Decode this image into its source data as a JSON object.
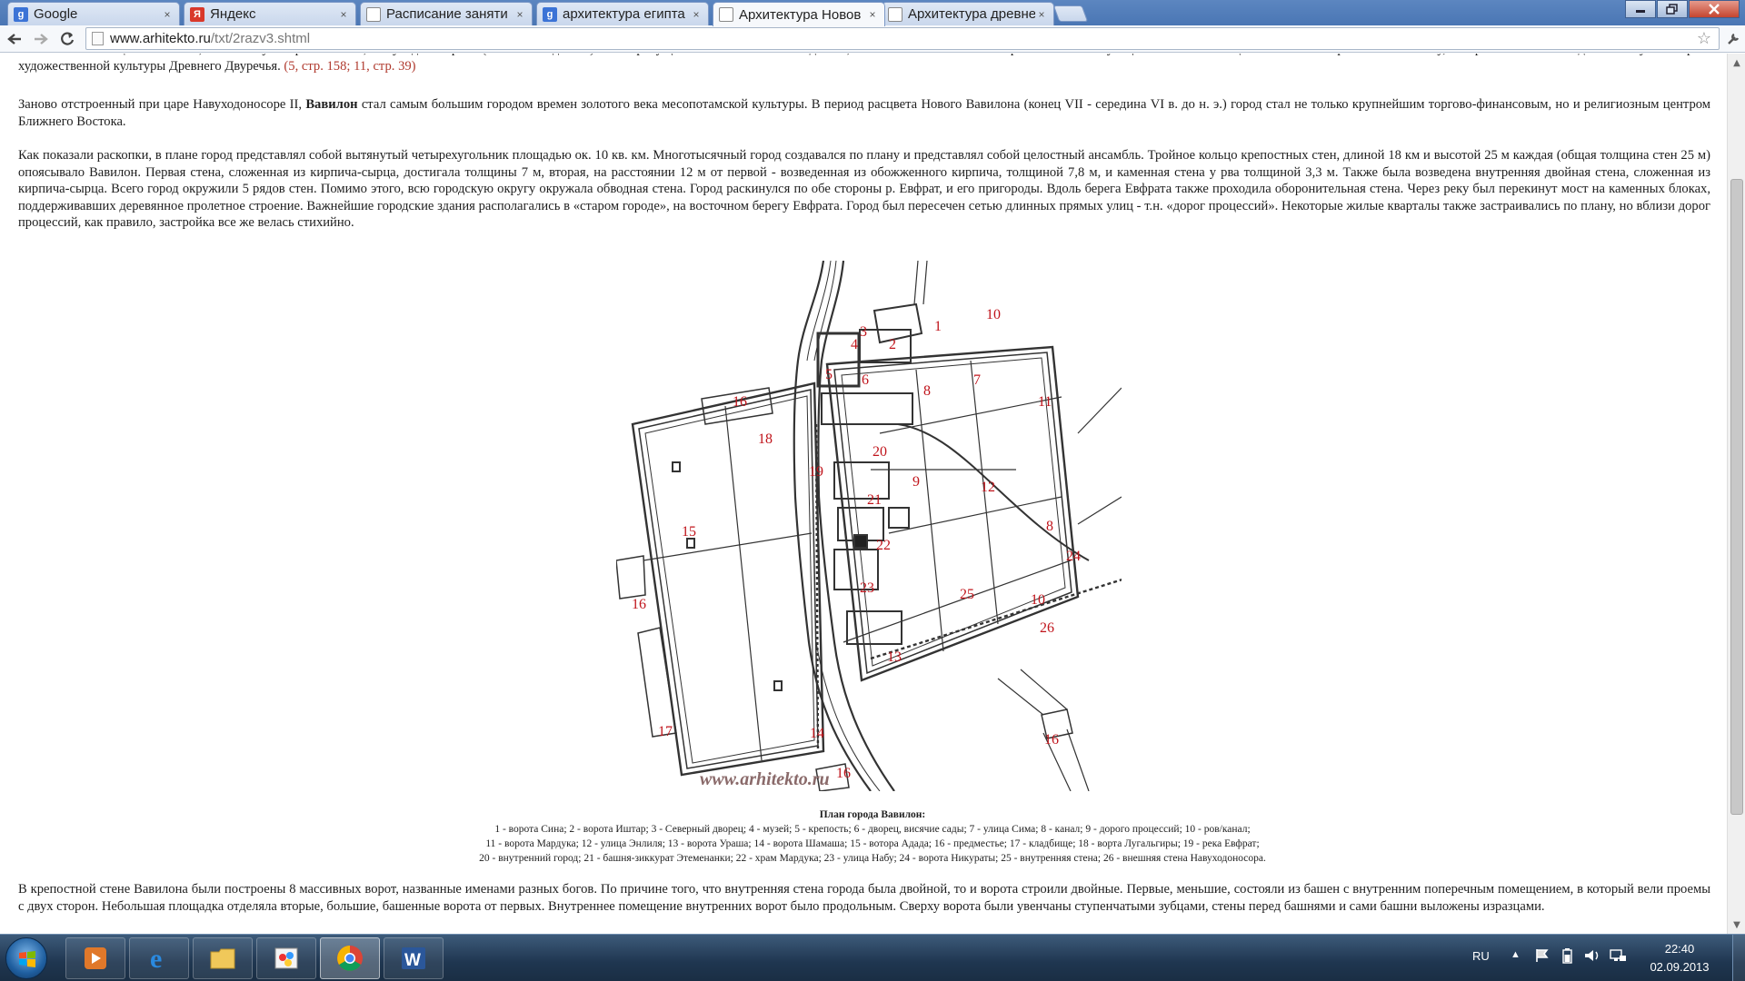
{
  "browser": {
    "tabs": [
      {
        "label": "Google",
        "icon": "g-icon",
        "color": "#3b73d6"
      },
      {
        "label": "Яндекс",
        "icon": "yandex-icon",
        "color": "#d9382a"
      },
      {
        "label": "Расписание заняти",
        "icon": "doc-icon",
        "color": "#777777"
      },
      {
        "label": "архитектура египта",
        "icon": "g-icon",
        "color": "#3b73d6"
      },
      {
        "label": "Архитектура Новов",
        "icon": "doc-icon",
        "color": "#777777"
      },
      {
        "label": "Архитектура древне",
        "icon": "doc-icon",
        "color": "#777777"
      }
    ],
    "tab_close": "×",
    "url_host": "www.arhitekto.ru",
    "url_path": "/txt/2razv3.shtml"
  },
  "content": {
    "p1_text": "особенно в столице - Вавилоне, началось уже при его сыне, Навуходоносоре II (605-563 гг. до н.э.). Она просуществовала в 626-538 гг. до н.э., пока не была завоевана Персией. Главенствующее положение на целое столетие перешло к Вавилону, который вписал последнюю главу в историю художественной культуры Древнего Двуречья.",
    "p1_ref": "(5, стр. 158; 11, стр. 39)",
    "p2_start": "Заново отстроенный при царе Навуходоносоре II,",
    "p2_bold": "Вавилон",
    "p2_end": "стал самым большим городом времен золотого века месопотамской культуры. В период расцвета Нового Вавилона (конец VII - середина VI в. до н. э.) город стал не только крупнейшим торгово-финансовым, но и религиозным центром Ближнего Востока.",
    "p3": "Как показали раскопки, в плане город представлял собой вытянутый четырехугольник площадью ок. 10 кв. км. Многотысячный город создавался по плану и представлял собой целостный ансамбль. Тройное кольцо крепостных стен, длиной 18 км и высотой 25 м каждая (общая толщина стен 25 м) опоясывало Вавилон. Первая стена, сложенная из кирпича-сырца, достигала толщины 7 м, вторая, на расстоянии 12 м от первой - возведенная из обожженного кирпича, толщиной 7,8 м, и каменная стена у рва толщиной 3,3 м. Также была возведена внутренняя двойная стена, сложенная из кирпича-сырца. Всего город окружили 5 рядов стен. Помимо этого, всю городскую округу окружала обводная стена. Город раскинулся по обе стороны р. Евфрат, и его пригороды. Вдоль берега Евфрата также проходила оборонительная стена. Через реку был перекинут мост на каменных блоках, поддерживавших деревянное пролетное строение. Важнейшие городские здания располагались в «старом городе», на восточном берегу Евфрата. Город был пересечен сетью длинных прямых улиц - т.н. «дорог процессий». Некоторые жилые кварталы также застраивались по плану, но вблизи дорог процессий, как правило, застройка все же велась стихийно.",
    "plan_watermark": "www.arhitekto.ru",
    "caption_title": "План города Вавилон:",
    "caption_lines": [
      "1 - ворота Сина; 2 - ворота Иштар; 3 - Северный дворец; 4 - музей; 5 - крепость; 6 - дворец, висячие сады; 7 - улица Сима; 8 - канал; 9 - дорого процессий; 10 - ров/канал;",
      "11 - ворота Мардука; 12 - улица Энлиля; 13 - ворота Ураша; 14 - ворота Шамаша; 15 - вотора Адада; 16 - предместье; 17 - кладбище; 18 - ворта Лугальгиры; 19 - река Евфрат;",
      "20 - внутренний город; 21 - башня-зиккурат Этеменанки; 22 - храм Мардука; 23 - улица Набу; 24 - ворота Никураты; 25 - внутренняя стена; 26 - внешняя стена Навуходоносора."
    ],
    "p4": "В крепостной стене Вавилона были построены 8 массивных ворот, названные именами разных богов. По причине того, что внутренняя стена города была двойной, то и ворота строили двойные. Первые, меньшие, состояли из башен с внутренним поперечным помещением, в который вели проемы с двух сторон. Небольшая площадка отделяла вторые, большие, башенные ворота от первых. Внутреннее помещение внутренних ворот было продольным. Сверху ворота были увенчаны ступенчатыми зубцами, стены перед башнями и сами башни выложены изразцами."
  },
  "plan_labels": [
    "1",
    "2",
    "3",
    "4",
    "5",
    "6",
    "7",
    "8",
    "8",
    "9",
    "10",
    "10",
    "11",
    "12",
    "13",
    "14",
    "15",
    "16",
    "16",
    "16",
    "16",
    "17",
    "18",
    "19",
    "20",
    "21",
    "22",
    "23",
    "24",
    "25",
    "26"
  ],
  "taskbar": {
    "apps": [
      "explorer",
      "media-player",
      "internet-explorer",
      "folder",
      "paint",
      "chrome",
      "word"
    ],
    "lang": "RU",
    "time": "22:40",
    "date": "02.09.2013"
  },
  "colors": {
    "plan_label": "#c0141b",
    "link_ref": "#b03a2e"
  }
}
